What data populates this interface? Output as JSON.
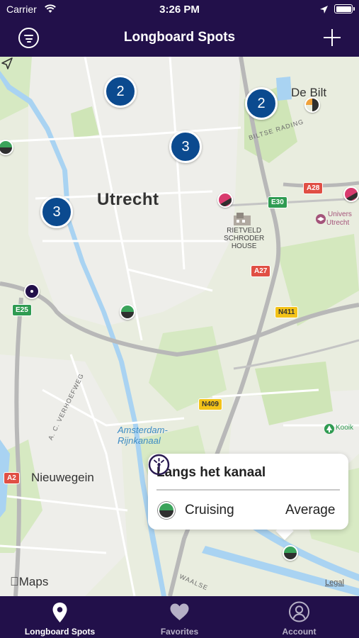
{
  "status_bar": {
    "carrier": "Carrier",
    "time": "3:26 PM"
  },
  "header": {
    "title": "Longboard Spots",
    "filter_icon": "filter-lines-icon",
    "add_icon": "plus-icon"
  },
  "map": {
    "place_labels": {
      "utrecht": "Utrecht",
      "de_bilt": "De Bilt",
      "nieuwegein": "Nieuwegein",
      "univ": "Univers",
      "univ2": "Utrecht",
      "rietveld": "RIETVELD\nSCHRODER\nHOUSE",
      "canal": "Amsterdam-\nRijnkanaal",
      "kooik": "Kooik",
      "e_fragment": "e"
    },
    "street_labels": {
      "biltse": "BILTSE RADING",
      "verhoefweg": "A. C. VERHOEFWEG",
      "waalse": "WAALSE"
    },
    "road_shields": {
      "a28": "A28",
      "e30": "E30",
      "a27": "A27",
      "n411": "N411",
      "e25": "E25",
      "n409": "N409",
      "a2": "A2"
    },
    "clusters": [
      "2",
      "2",
      "3",
      "3"
    ],
    "attribution": "Maps",
    "legal": "Legal"
  },
  "callout": {
    "title": "Langs het kanaal",
    "level": "Cruising",
    "difficulty": "Average"
  },
  "tabs": [
    {
      "label": "Longboard Spots",
      "icon": "map-pin-icon",
      "selected": true
    },
    {
      "label": "Favorites",
      "icon": "heart-icon",
      "selected": false
    },
    {
      "label": "Account",
      "icon": "person-icon",
      "selected": false
    }
  ],
  "colors": {
    "header_bg": "#22104a",
    "cluster_blue": "#0b4a8f",
    "cruising_green": "#3aa35a"
  }
}
